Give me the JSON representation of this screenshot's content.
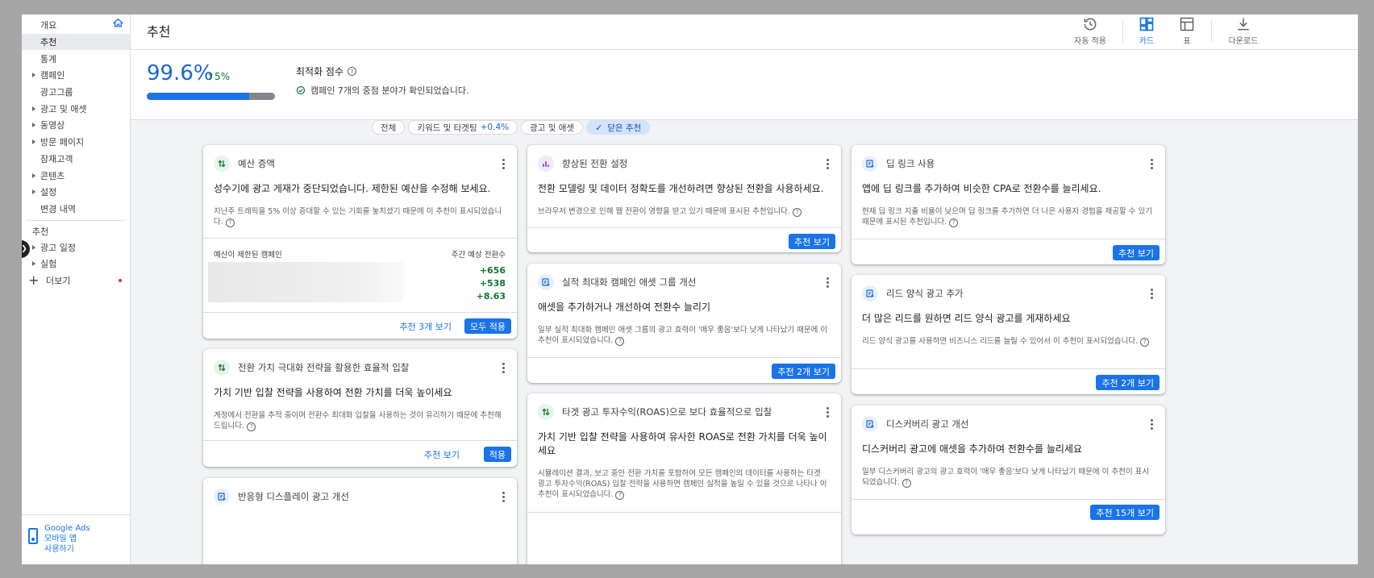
{
  "sidebar": {
    "items": [
      {
        "label": "개요",
        "caret": false
      },
      {
        "label": "추천",
        "caret": false,
        "active": true
      },
      {
        "label": "통계",
        "caret": false
      },
      {
        "label": "캠페인",
        "caret": true
      },
      {
        "label": "광고그룹",
        "caret": false
      },
      {
        "label": "광고 및 애셋",
        "caret": true
      },
      {
        "label": "동영상",
        "caret": true
      },
      {
        "label": "방문 페이지",
        "caret": true
      },
      {
        "label": "잠재고객",
        "caret": false
      },
      {
        "label": "콘텐츠",
        "caret": true
      },
      {
        "label": "설정",
        "caret": true
      },
      {
        "label": "변경 내역",
        "caret": false
      }
    ],
    "section_label": "추천",
    "section_items": [
      {
        "label": "광고 일정",
        "caret": true
      },
      {
        "label": "실험",
        "caret": true
      }
    ],
    "more_label": "더보기",
    "mobile_promo": {
      "line1": "Google Ads",
      "line2": "모바일 앱",
      "line3": "사용하기"
    }
  },
  "header": {
    "title": "추천",
    "tools": {
      "auto_apply": "자동 적용",
      "cards": "카드",
      "table": "표",
      "download": "다운로드"
    }
  },
  "score": {
    "value": "99.6%",
    "delta": "↑5%",
    "progress": 0.8,
    "title": "최적화 점수",
    "subtitle": "캠페인 7개의 중점 분야가 확인되었습니다."
  },
  "filters": {
    "all": "전체",
    "keywords": "키워드 및 타겟팅",
    "keywords_delta": "+0.4%",
    "ads": "광고 및 애셋",
    "dismissed": "닫은 추천"
  },
  "cards": {
    "budget": {
      "title": "예산 증액",
      "main": "성수기에 광고 게재가 중단되었습니다. 제한된 예산을 수정해 보세요.",
      "desc": "지난주 트래픽을 5% 이상 증대할 수 있는 기회를 놓치셨기 때문에 이 추천이 표시되었습니다.",
      "col_left": "예산이 제한된 캠페인",
      "col_right": "주간 예상 전환수",
      "metrics": [
        "+656",
        "+538",
        "+8.63"
      ],
      "view_btn": "추천 3개 보기",
      "apply_btn": "모두 적용"
    },
    "value_bidding": {
      "title": "전환 가치 극대화 전략을 활용한 효율적 입찰",
      "main": "가치 기반 입찰 전략을 사용하여 전환 가치를 더욱 높이세요",
      "desc": "계정에서 전환을 추적 중이며 전환수 최대화 입찰을 사용하는 것이 유리하기 때문에 추천해드립니다.",
      "view_btn": "추천 보기",
      "apply_btn": "적용"
    },
    "responsive_display": {
      "title": "반응형 디스플레이 광고 개선"
    },
    "enhanced_conv": {
      "title": "향상된 전환 설정",
      "main": "전환 모델링 및 데이터 정확도를 개선하려면 향상된 전환을 사용하세요.",
      "desc": "브라우저 변경으로 인해 웹 전환이 영향을 받고 있기 때문에 표시된 추천입니다.",
      "view_btn": "추천 보기"
    },
    "pmax": {
      "title": "실적 최대화 캠페인 애셋 그룹 개선",
      "main": "애셋을 추가하거나 개선하여 전환수 늘리기",
      "desc": "일부 실적 최대화 캠페인 애셋 그룹의 광고 효력이 '매우 좋음'보다 낮게 나타났기 때문에 이 추천이 표시되었습니다.",
      "view_btn": "추천 2개 보기"
    },
    "troas": {
      "title": "타겟 광고 투자수익(ROAS)으로 보다 효율적으로 입찰",
      "main": "가치 기반 입찰 전략을 사용하여 유사한 ROAS로 전환 가치를 더욱 높이세요",
      "desc": "시뮬레이션 결과, 보고 중인 전환 가치를 포함하여 모든 캠페인의 데이터를 사용하는 타겟 광고 투자수익(ROAS) 입찰 전략을 사용하면 캠페인 실적을 높일 수 있을 것으로 나타나 이 추천이 표시되었습니다."
    },
    "deeplink": {
      "title": "딥 링크 사용",
      "main": "앱에 딥 링크를 추가하여 비슷한 CPA로 전환수를 늘리세요.",
      "desc": "현재 딥 링크 지출 비율이 낮으며 딥 링크를 추가하면 더 나은 사용자 경험을 제공할 수 있기 때문에 표시된 추천입니다.",
      "view_btn": "추천 보기"
    },
    "lead_form": {
      "title": "리드 양식 광고 추가",
      "main": "더 많은 리드를 원하면 리드 양식 광고를 게재하세요",
      "desc": "리드 양식 광고를 사용하면 비즈니스 리드를 늘릴 수 있어서 이 추천이 표시되었습니다.",
      "view_btn": "추천 2개 보기"
    },
    "discovery": {
      "title": "디스커버리 광고 개선",
      "main": "디스커버리 광고에 애셋을 추가하여 전환수를 늘리세요",
      "desc": "일부 디스커버리 광고의 광고 효력이 '매우 좋음'보다 낮게 나타났기 때문에 이 추천이 표시되었습니다.",
      "view_btn": "추천 15개 보기"
    }
  },
  "colors": {
    "primary": "#1a73e8",
    "positive": "#137333",
    "chip_selected": "#d2e3fc"
  }
}
